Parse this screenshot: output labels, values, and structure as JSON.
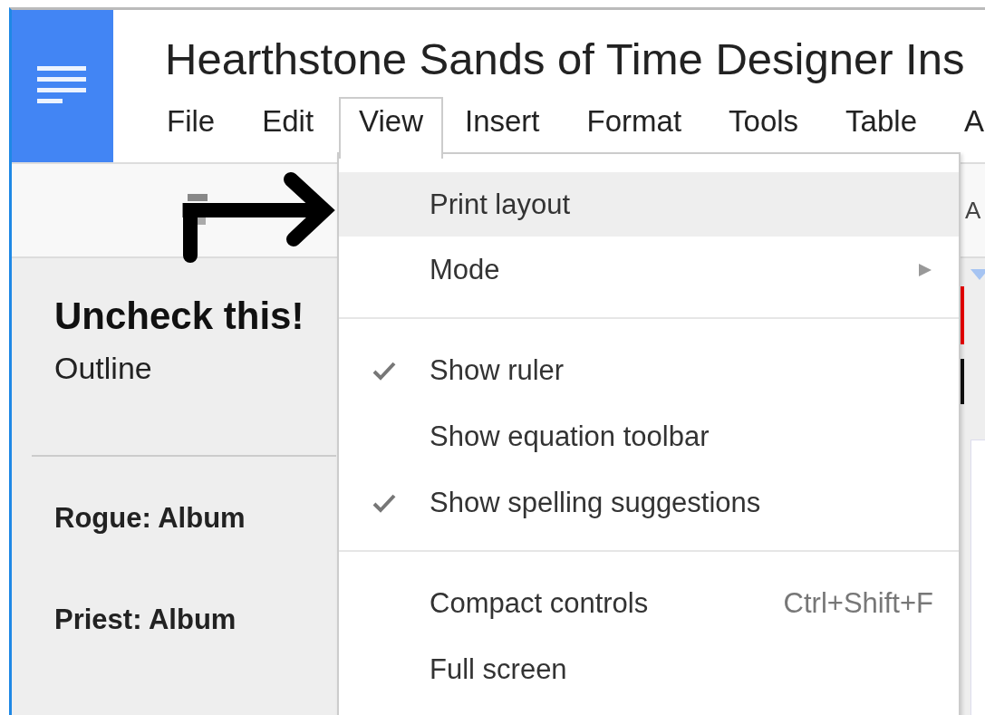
{
  "document": {
    "title": "Hearthstone Sands of Time Designer Ins"
  },
  "menu_bar": [
    {
      "label": "File",
      "selected": false
    },
    {
      "label": "Edit",
      "selected": false
    },
    {
      "label": "View",
      "selected": true
    },
    {
      "label": "Insert",
      "selected": false
    },
    {
      "label": "Format",
      "selected": false
    },
    {
      "label": "Tools",
      "selected": false
    },
    {
      "label": "Table",
      "selected": false
    },
    {
      "label": "A",
      "selected": false
    }
  ],
  "toolbar": {
    "font_label": "A"
  },
  "annotation": {
    "text": "Uncheck this!"
  },
  "sidebar": {
    "title": "Outline",
    "items": [
      {
        "label": "Rogue: Album"
      },
      {
        "label": "Priest: Album"
      }
    ]
  },
  "view_menu": [
    {
      "kind": "toggle",
      "label": "Print layout",
      "checked": false,
      "selected": true
    },
    {
      "kind": "submenu",
      "label": "Mode",
      "selected": false
    },
    {
      "kind": "separator"
    },
    {
      "kind": "toggle",
      "label": "Show ruler",
      "checked": true,
      "selected": false
    },
    {
      "kind": "toggle",
      "label": "Show equation toolbar",
      "checked": false,
      "selected": false
    },
    {
      "kind": "toggle",
      "label": "Show spelling suggestions",
      "checked": true,
      "selected": false
    },
    {
      "kind": "separator"
    },
    {
      "kind": "action",
      "label": "Compact controls",
      "shortcut": "Ctrl+Shift+F",
      "selected": false
    },
    {
      "kind": "action",
      "label": "Full screen",
      "selected": false
    }
  ]
}
